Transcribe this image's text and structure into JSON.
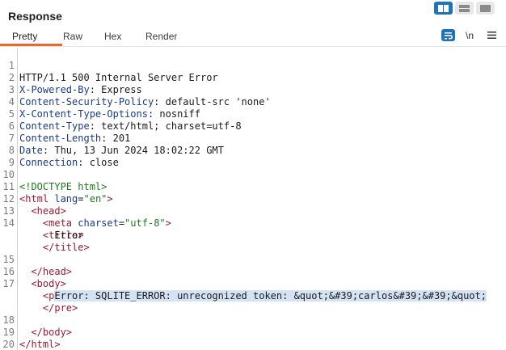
{
  "panel": {
    "title": "Response"
  },
  "tabs": [
    {
      "label": "Pretty"
    },
    {
      "label": "Raw"
    },
    {
      "label": "Hex"
    },
    {
      "label": "Render"
    }
  ],
  "toolbar": {
    "newline_label": "\\n",
    "icons": [
      "layout-split-icon",
      "layout-horizontal-icon",
      "layout-single-icon",
      "wrap-icon",
      "newline-icon",
      "menu-icon"
    ],
    "accent_color": "#1f73b7",
    "tab_underline_color": "#e46b2f"
  },
  "code": {
    "line_numbers": [
      "1",
      "2",
      "3",
      "4",
      "5",
      "6",
      "7",
      "8",
      "9",
      "10",
      "11",
      "12",
      "13",
      "14",
      "15",
      "16",
      "17",
      "18",
      "19",
      "20"
    ],
    "status_line": "HTTP/1.1 500 Internal Server Error",
    "headers": [
      {
        "name": "X-Powered-By",
        "sep": ": ",
        "value": "Express"
      },
      {
        "name": "Content-Security-Policy",
        "sep": ": ",
        "value": "default-src 'none'"
      },
      {
        "name": "X-Content-Type-Options",
        "sep": ": ",
        "value": "nosniff"
      },
      {
        "name": "Content-Type",
        "sep": ": ",
        "value": "text/html; charset=utf-8"
      },
      {
        "name": "Content-Length",
        "sep": ": ",
        "value": "201"
      },
      {
        "name": "Date",
        "sep": ": ",
        "value": "Thu, 13 Jun 2024 18:02:22 GMT"
      },
      {
        "name": "Connection",
        "sep": ": ",
        "value": "close"
      }
    ],
    "doctype": "<!DOCTYPE html>",
    "html_open": "<html",
    "lang_attr": "lang",
    "eq": "=",
    "lang_value": "\"en\"",
    "gt": ">",
    "head_open": "<head>",
    "meta_open": "<meta",
    "charset_attr": "charset",
    "charset_value": "\"utf-8\"",
    "title_open": "<title>",
    "title_text": "Error",
    "title_close": "</title>",
    "head_close": "</head>",
    "body_open": "<body>",
    "pre_open": "<pre>",
    "error_text": "Error: SQLITE_ERROR: unrecognized token: &quot;&#39;carlos&#39;&#39;&quot;",
    "pre_close": "</pre>",
    "body_close": "</body>",
    "html_close": "</html>"
  }
}
